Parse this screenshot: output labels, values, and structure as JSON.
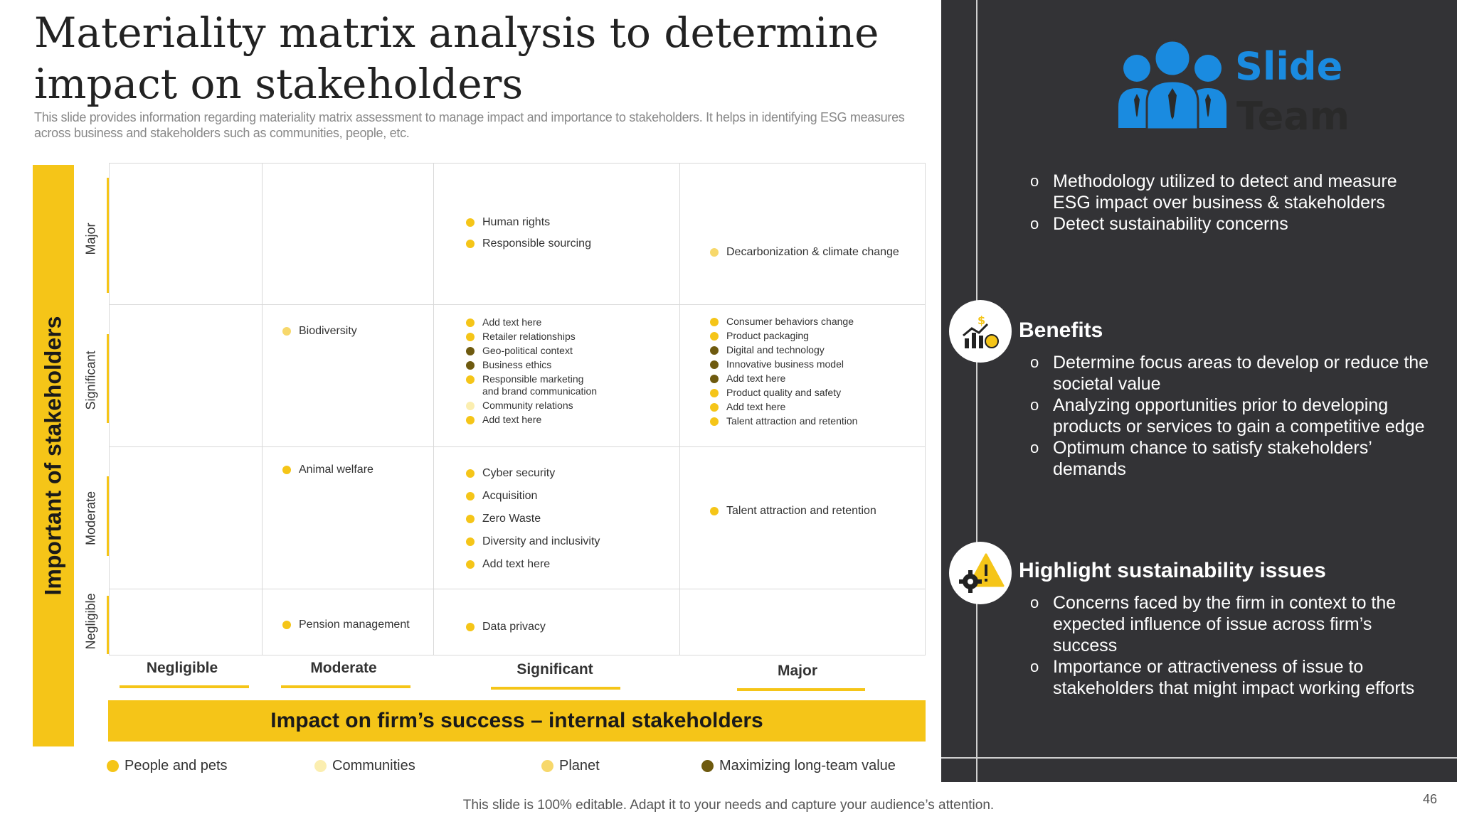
{
  "title": "Materiality matrix analysis to determine impact on stakeholders",
  "subtitle": "This slide provides information regarding materiality matrix assessment to manage impact and importance to stakeholders. It helps in identifying ESG measures across business and stakeholders such as communities, people, etc.",
  "matrix": {
    "y_axis_title": "Important of stakeholders",
    "x_axis_title": "Impact on firm’s success – internal stakeholders",
    "row_labels": [
      "Major",
      "Significant",
      "Moderate",
      "Negligible"
    ],
    "column_labels": [
      "Negligible",
      "Moderate",
      "Significant",
      "Major"
    ],
    "cells": {
      "major_significant": [
        {
          "text": "Human rights",
          "category": "people"
        },
        {
          "text": "Responsible sourcing",
          "category": "people"
        }
      ],
      "major_major": [
        {
          "text": "Decarbonization & climate change",
          "category": "planet"
        }
      ],
      "significant_moderate": [
        {
          "text": "Biodiversity",
          "category": "planet"
        }
      ],
      "significant_significant": [
        {
          "text": "Add text here",
          "category": "people"
        },
        {
          "text": "Retailer relationships",
          "category": "people"
        },
        {
          "text": "Geo-political context",
          "category": "value"
        },
        {
          "text": "Business ethics",
          "category": "value"
        },
        {
          "text": "Responsible marketing\nand brand communication",
          "category": "people"
        },
        {
          "text": "Community relations",
          "category": "communities"
        },
        {
          "text": "Add text here",
          "category": "people"
        }
      ],
      "significant_major": [
        {
          "text": "Consumer behaviors change",
          "category": "people"
        },
        {
          "text": "Product packaging",
          "category": "people"
        },
        {
          "text": "Digital and technology",
          "category": "value"
        },
        {
          "text": "Innovative business model",
          "category": "value"
        },
        {
          "text": "Add text here",
          "category": "value"
        },
        {
          "text": "Product quality and safety",
          "category": "people"
        },
        {
          "text": "Add text here",
          "category": "people"
        },
        {
          "text": "Talent attraction and retention",
          "category": "people"
        }
      ],
      "moderate_moderate": [
        {
          "text": "Animal welfare",
          "category": "people"
        }
      ],
      "moderate_significant": [
        {
          "text": "Cyber security",
          "category": "people"
        },
        {
          "text": "Acquisition",
          "category": "people"
        },
        {
          "text": "Zero Waste",
          "category": "people"
        },
        {
          "text": "Diversity and inclusivity",
          "category": "people"
        },
        {
          "text": "Add text here",
          "category": "people"
        }
      ],
      "moderate_major": [
        {
          "text": "Talent attraction and retention",
          "category": "people"
        }
      ],
      "negligible_moderate": [
        {
          "text": "Pension management",
          "category": "people"
        }
      ],
      "negligible_significant": [
        {
          "text": "Data privacy",
          "category": "people"
        }
      ]
    }
  },
  "legend": [
    {
      "label": "People  and pets",
      "category": "people"
    },
    {
      "label": "Communities",
      "category": "communities"
    },
    {
      "label": "Planet",
      "category": "planet"
    },
    {
      "label": "Maximizing long-team value",
      "category": "value"
    }
  ],
  "colors": {
    "accent": "#f5c518",
    "people": "#f5c518",
    "communities": "#fbeeb0",
    "planet": "#f7d86b",
    "value": "#6e5a0f",
    "panel_bg": "#333336",
    "logo_blue": "#1a8be0",
    "logo_dark": "#2a2a2a"
  },
  "panel": {
    "logo": {
      "word1": "Slide",
      "word2": "Team",
      "icon": "people-group-icon"
    },
    "intro_points": [
      "Methodology utilized to detect and measure ESG impact over business & stakeholders",
      "Detect sustainability concerns"
    ],
    "benefits": {
      "heading": "Benefits",
      "icon": "chart-coin-icon",
      "points": [
        "Determine focus areas to develop or reduce the societal value",
        "Analyzing opportunities prior to developing products or services to gain a competitive edge",
        "Optimum chance to satisfy stakeholders’ demands"
      ]
    },
    "issues": {
      "heading": "Highlight sustainability issues",
      "icon": "gear-warning-icon",
      "points": [
        "Concerns faced by the firm in context to the expected influence of issue across firm’s success",
        "Importance or attractiveness of issue to stakeholders that might impact working efforts"
      ]
    }
  },
  "footer": "This slide is 100% editable. Adapt it to your needs and capture your audience’s attention.",
  "page_number": "46"
}
